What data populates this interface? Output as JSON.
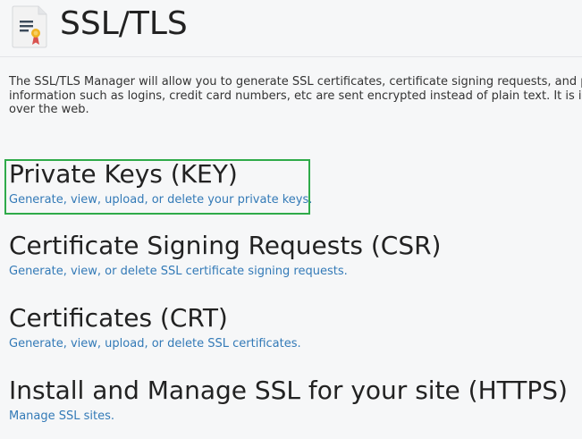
{
  "header": {
    "title": "SSL/TLS",
    "icon": "certificate-document-icon",
    "colors": {
      "icon_paper": "#f2f2f2",
      "icon_lines": "#3b4a5a",
      "icon_seal": "#f0b323",
      "icon_ribbon": "#d9534f"
    }
  },
  "intro": {
    "line1": "The SSL/TLS Manager will allow you to generate SSL certificates, certificate signing requests, and pr",
    "line2": "information such as logins, credit card numbers, etc are sent encrypted instead of plain text. It is im",
    "line3": "over the web."
  },
  "sections": [
    {
      "title": "Private Keys (KEY)",
      "link": "Generate, view, upload, or delete your private keys."
    },
    {
      "title": "Certificate Signing Requests (CSR)",
      "link": "Generate, view, or delete SSL certificate signing requests."
    },
    {
      "title": "Certificates (CRT)",
      "link": "Generate, view, upload, or delete SSL certificates."
    },
    {
      "title": "Install and Manage SSL for your site (HTTPS)",
      "link": "Manage SSL sites."
    }
  ],
  "colors": {
    "link": "#337ab7",
    "highlight": "#2fab4a",
    "background": "#f6f7f8"
  }
}
